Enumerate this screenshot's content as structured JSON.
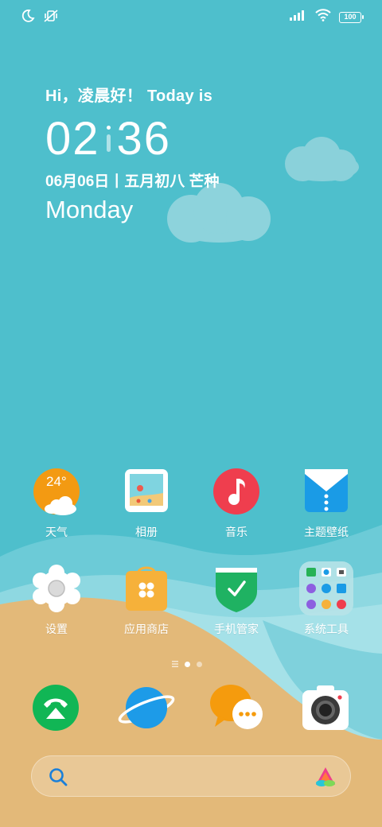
{
  "status": {
    "battery": "100"
  },
  "widget": {
    "greeting": "Hi，凌晨好！ Today is",
    "hour": "02",
    "minute": "36",
    "date": "06月06日丨五月初八 芒种",
    "weekday": "Monday"
  },
  "apps": [
    {
      "label": "天气",
      "temp": "24°"
    },
    {
      "label": "相册"
    },
    {
      "label": "音乐"
    },
    {
      "label": "主题壁纸"
    },
    {
      "label": "设置"
    },
    {
      "label": "应用商店"
    },
    {
      "label": "手机管家"
    },
    {
      "label": "系统工具"
    }
  ],
  "colors": {
    "sky": "#4ebfcc",
    "sand": "#e3b979",
    "weather": "#f39a12",
    "music": "#ef3e4e",
    "theme": "#1a9be6",
    "store": "#f6b13a",
    "security": "#1fb262",
    "phone": "#11b655",
    "browser": "#1d9be8",
    "messages": "#f59b0d"
  }
}
